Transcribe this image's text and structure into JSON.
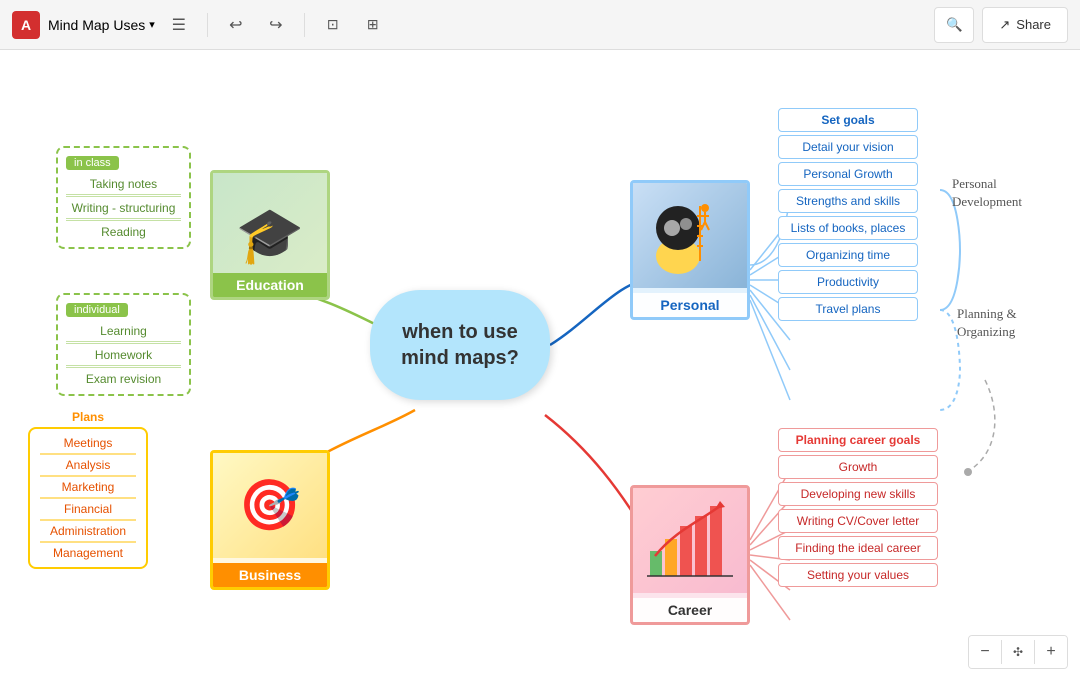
{
  "toolbar": {
    "logo": "A",
    "title": "Mind Map Uses",
    "hamburger_label": "☰",
    "undo_label": "↩",
    "redo_label": "↪",
    "frame_label": "⊞",
    "layout_label": "⊟",
    "search_label": "🔍",
    "share_label": "Share"
  },
  "center": {
    "text": "when to use\nmind maps?"
  },
  "education": {
    "label": "Education",
    "in_class_tag": "in class",
    "in_class_items": [
      "Taking notes",
      "Writing - structuring",
      "Reading"
    ],
    "individual_tag": "individual",
    "individual_items": [
      "Learning",
      "Homework",
      "Exam revision"
    ]
  },
  "personal": {
    "label": "Personal",
    "items": [
      "Set goals",
      "Detail your vision",
      "Personal Growth",
      "Strengths and skills",
      "Lists of books, places",
      "Organizing time",
      "Productivity",
      "Travel plans"
    ],
    "personal_dev_label": "Personal\nDevelopment",
    "planning_label": "Planning &\nOrganizing"
  },
  "business": {
    "label": "Business",
    "tag": "Plans",
    "items": [
      "Meetings",
      "Analysis",
      "Marketing",
      "Financial",
      "Administration",
      "Management"
    ]
  },
  "career": {
    "label": "Career",
    "top_item": "Planning career goals",
    "items": [
      "Growth",
      "Developing new skills",
      "Writing CV/Cover letter",
      "Finding the ideal career",
      "Setting  your values"
    ]
  },
  "zoom": {
    "minus": "−",
    "fit": "⊞",
    "plus": "+"
  }
}
